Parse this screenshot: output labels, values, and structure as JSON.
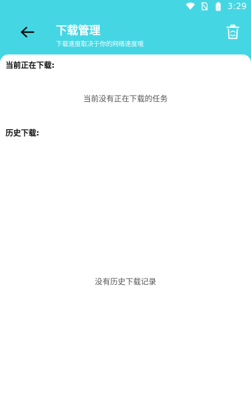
{
  "status_bar": {
    "time": "3:29",
    "icons": [
      "wifi-icon",
      "no-sim-icon",
      "battery-icon"
    ]
  },
  "header": {
    "title": "下载管理",
    "subtitle": "下载速度取决于你的网络速度哦",
    "back_icon": "arrow-left-icon",
    "trash_icon": "trash-icon"
  },
  "sections": {
    "current": {
      "title": "当前正在下载:",
      "empty_message": "当前没有正在下载的任务"
    },
    "history": {
      "title": "历史下载:",
      "empty_message": "没有历史下载记录"
    }
  },
  "colors": {
    "accent": "#45d6e3",
    "background": "#ffffff"
  }
}
